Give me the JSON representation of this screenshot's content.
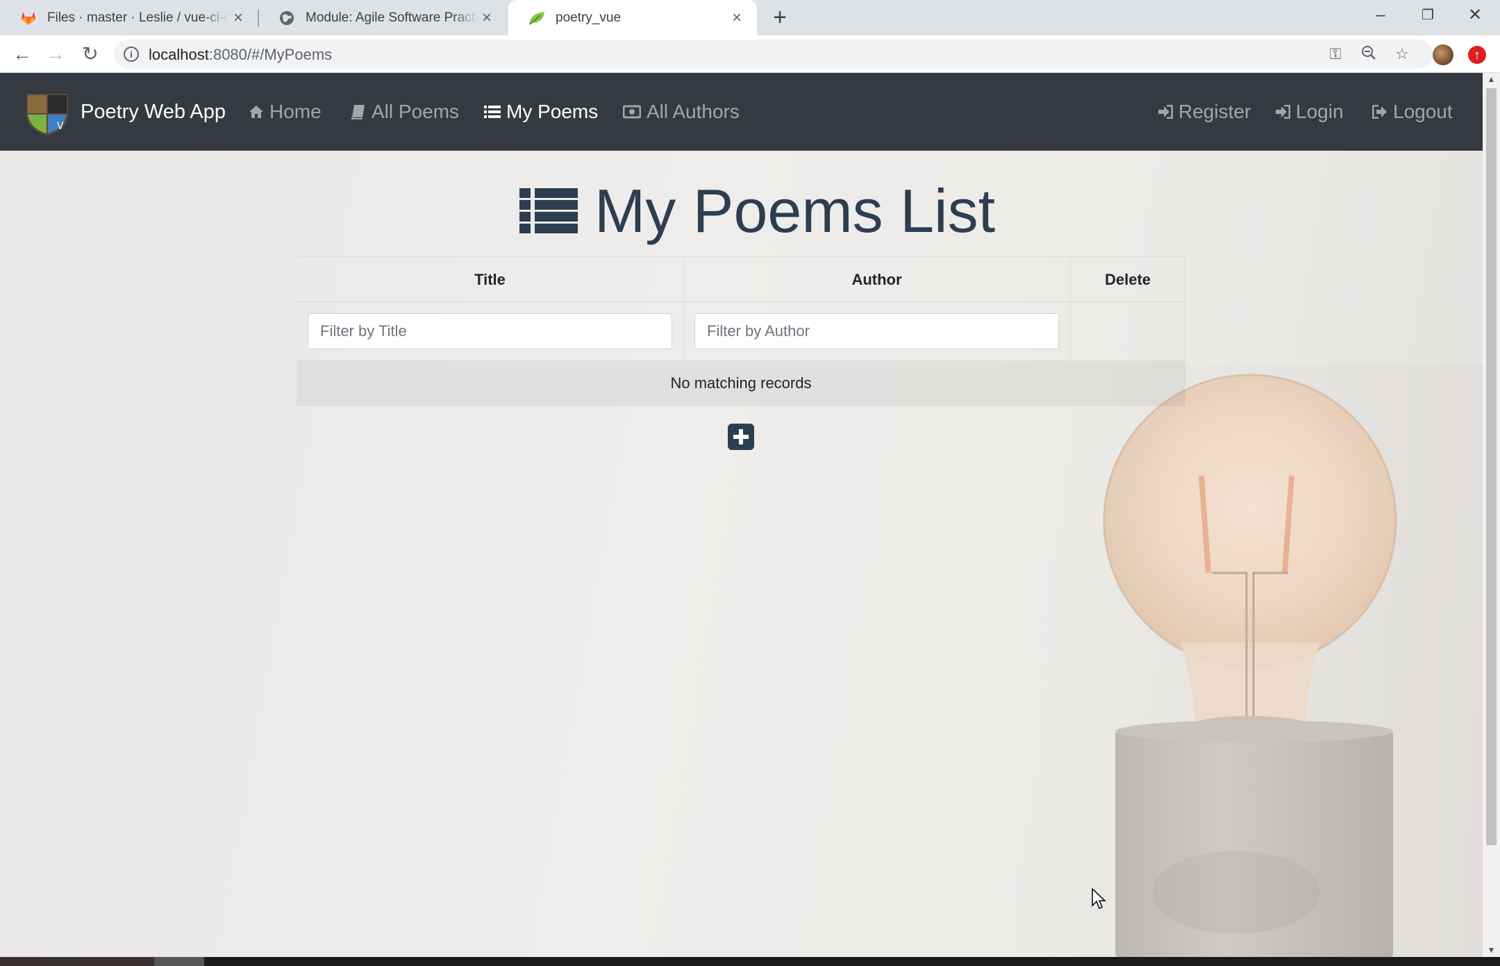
{
  "browser": {
    "tabs": [
      {
        "title": "Files · master · Leslie / vue-ci-cd",
        "favicon": "gitlab-icon"
      },
      {
        "title": "Module: Agile Software Practice",
        "favicon": "globe-icon"
      },
      {
        "title": "poetry_vue",
        "favicon": "leaf-icon",
        "active": true
      }
    ],
    "url_host": "localhost",
    "url_rest": ":8080/#/MyPoems"
  },
  "navbar": {
    "brand": "Poetry Web App",
    "items": [
      {
        "label": "Home",
        "icon": "home-icon"
      },
      {
        "label": "All Poems",
        "icon": "book-icon"
      },
      {
        "label": "My Poems",
        "icon": "list-icon",
        "active": true
      },
      {
        "label": "All Authors",
        "icon": "id-card-icon"
      }
    ],
    "right_items": [
      {
        "label": "Register",
        "icon": "sign-in-icon"
      },
      {
        "label": "Login",
        "icon": "sign-in-icon"
      },
      {
        "label": "Logout",
        "icon": "sign-out-icon"
      }
    ]
  },
  "page": {
    "heading": "My Poems List",
    "table": {
      "columns": [
        "Title",
        "Author",
        "Delete"
      ],
      "filters": {
        "title_placeholder": "Filter by Title",
        "author_placeholder": "Filter by Author"
      },
      "empty_text": "No matching records"
    },
    "add_button_icon": "plus-square-icon"
  },
  "colors": {
    "navbar_bg": "#343a40",
    "heading": "#2c3e50",
    "nav_active": "#ffffff",
    "nav_muted": "rgba(255,255,255,0.55)"
  }
}
